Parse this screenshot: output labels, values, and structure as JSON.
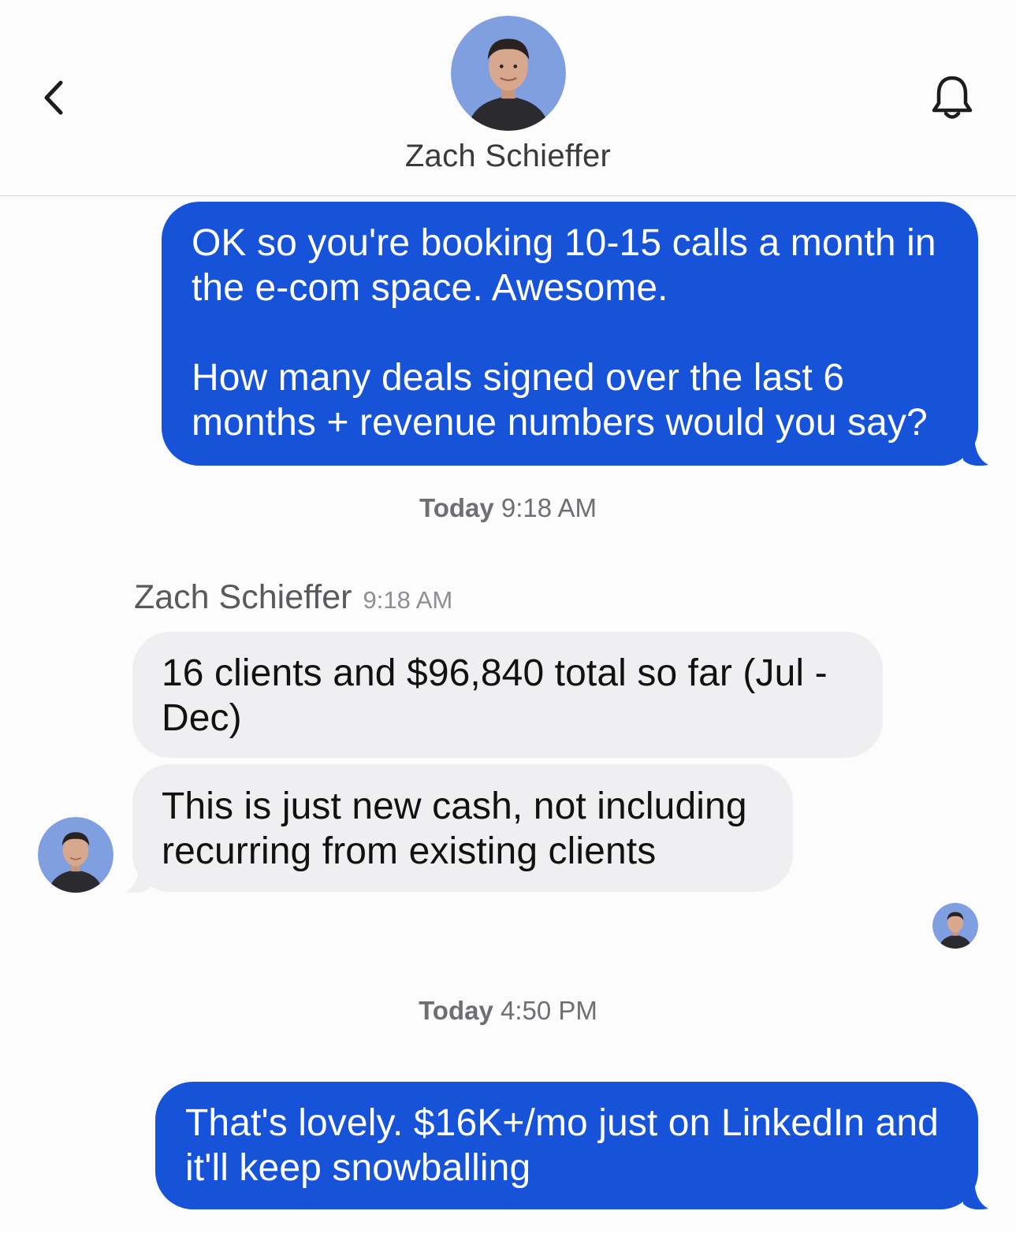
{
  "header": {
    "contact_name": "Zach Schieffer",
    "back_icon": "chevron-left-icon",
    "bell_icon": "bell-icon"
  },
  "messages": [
    {
      "direction": "outgoing",
      "text": "OK so you're booking 10-15 calls a month in\nthe e-com space. Awesome.\n\nHow many deals signed over the last 6\nmonths + revenue numbers would you say?"
    },
    {
      "direction": "incoming",
      "text": "16 clients and $96,840 total so far (Jul -\nDec)"
    },
    {
      "direction": "incoming",
      "text": "This is just new cash, not including\nrecurring from existing clients"
    },
    {
      "direction": "outgoing",
      "text": "That's lovely. $16K+/mo just on LinkedIn and\nit'll keep snowballing"
    }
  ],
  "timestamps": [
    {
      "day": "Today",
      "time": "9:18 AM"
    },
    {
      "day": "Today",
      "time": "4:50 PM"
    }
  ],
  "sender_line": {
    "name": "Zach Schieffer",
    "time": "9:18 AM"
  },
  "colors": {
    "outgoing_bubble": "#1653d9",
    "incoming_bubble": "#efeff1",
    "avatar_bg": "#7f9fe0"
  }
}
